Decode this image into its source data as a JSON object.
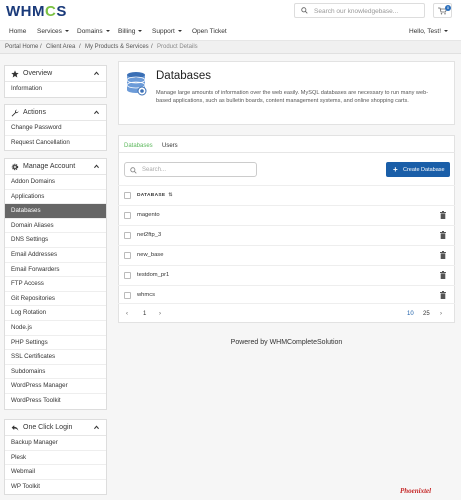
{
  "header": {
    "logo": "WHMCS",
    "search_placeholder": "Search our knowledgebase...",
    "cart_count": "0"
  },
  "nav": {
    "items": [
      {
        "label": "Home"
      },
      {
        "label": "Services"
      },
      {
        "label": "Domains"
      },
      {
        "label": "Billing"
      },
      {
        "label": "Support"
      },
      {
        "label": "Open Ticket"
      }
    ],
    "user": "Hello, Test!"
  },
  "breadcrumb": [
    "Portal Home",
    "Client Area",
    "My Products & Services",
    "Product Details"
  ],
  "sidebar": {
    "overview": {
      "title": "Overview",
      "items": [
        "Information"
      ]
    },
    "actions": {
      "title": "Actions",
      "items": [
        "Change Password",
        "Request Cancellation"
      ]
    },
    "manage": {
      "title": "Manage Account",
      "items": [
        "Addon Domains",
        "Applications",
        "Databases",
        "Domain Aliases",
        "DNS Settings",
        "Email Addresses",
        "Email Forwarders",
        "FTP Access",
        "Git Repositories",
        "Log Rotation",
        "Node.js",
        "PHP Settings",
        "SSL Certificates",
        "Subdomains",
        "WordPress Manager",
        "WordPress Toolkit"
      ],
      "active": "Databases"
    },
    "oneclick": {
      "title": "One Click Login",
      "items": [
        "Backup Manager",
        "Plesk",
        "Webmail",
        "WP Toolkit"
      ]
    }
  },
  "intro": {
    "title": "Databases",
    "description": "Manage large amounts of information over the web easily. MySQL databases are necessary to run many web-based applications, such as bulletin boards, content management systems, and online shopping carts."
  },
  "tabs": [
    "Databases",
    "Users"
  ],
  "table": {
    "search_placeholder": "Search...",
    "create_label": "Create Database",
    "column": "DATABASE",
    "rows": [
      "magento",
      "net2ftp_3",
      "new_base",
      "testdom_pr1",
      "whmcs"
    ]
  },
  "pagination": {
    "page": "1",
    "sizes": [
      "10",
      "25"
    ]
  },
  "footer": "Powered by WHMCompleteSolution",
  "brand": "Phoenixtel",
  "colors": {
    "accent": "#1a5ea8",
    "active_tab": "#5cb85c",
    "active_sidebar": "#666666"
  }
}
